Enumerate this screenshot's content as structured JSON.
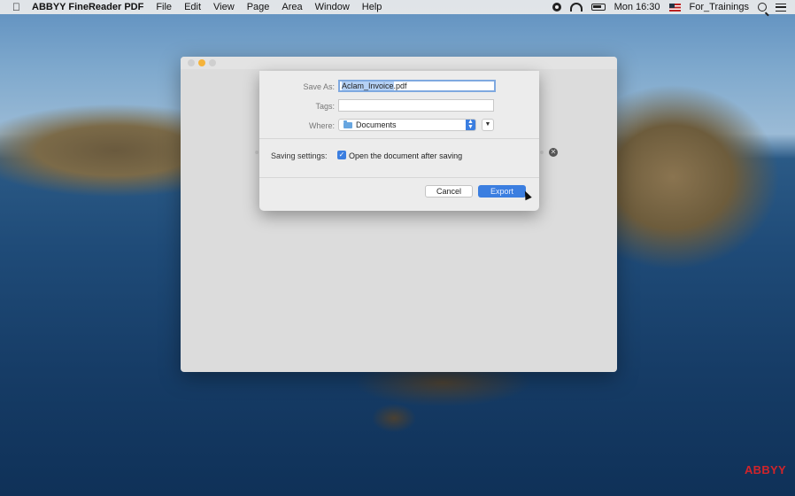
{
  "menubar": {
    "app_name": "ABBYY FineReader PDF",
    "menus": [
      "File",
      "Edit",
      "View",
      "Page",
      "Area",
      "Window",
      "Help"
    ],
    "clock": "Mon 16:30",
    "user": "For_Trainings"
  },
  "save_dialog": {
    "save_as_label": "Save As:",
    "file_name_selected": "Aclam_Invoice",
    "file_extension": ".pdf",
    "tags_label": "Tags:",
    "tags_value": "",
    "where_label": "Where:",
    "where_value": "Documents",
    "saving_settings_label": "Saving settings:",
    "open_after_saving_label": "Open the document after saving",
    "open_after_saving_checked": true,
    "cancel_label": "Cancel",
    "export_label": "Export"
  },
  "watermark": "ABBYY",
  "colors": {
    "accent": "#3b7ee0",
    "watermark": "#d1242a",
    "traffic_minimize": "#f5b33a"
  },
  "icons": [
    "apple-icon",
    "screen-record-icon",
    "wifi-icon",
    "battery-icon",
    "flag-icon",
    "search-icon",
    "list-icon",
    "folder-icon",
    "updown-icon",
    "chevron-down-icon",
    "close-icon",
    "cursor-icon"
  ]
}
